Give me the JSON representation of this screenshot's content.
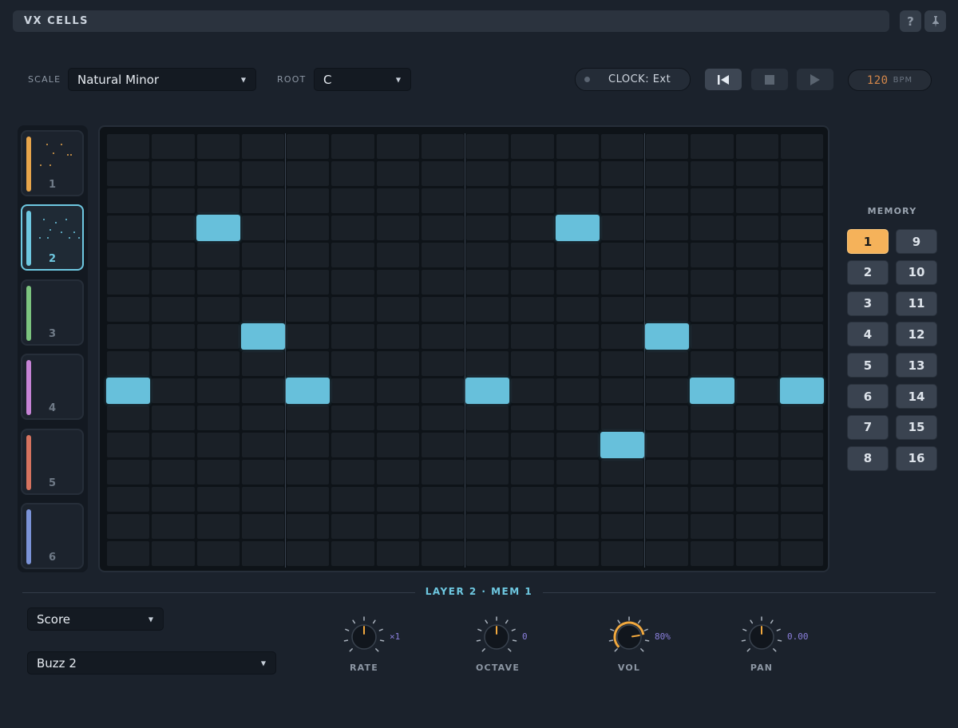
{
  "app": {
    "title": "VX CELLS",
    "help_label": "?",
    "pin_icon": "pin-icon"
  },
  "controls": {
    "scale_label": "SCALE",
    "scale_value": "Natural Minor",
    "root_label": "ROOT",
    "root_value": "C",
    "clock_label": "CLOCK: Ext",
    "bpm_value": "120",
    "bpm_unit": "BPM"
  },
  "layers": [
    {
      "label": "1",
      "color": "#e7a54b"
    },
    {
      "label": "2",
      "color": "#6ec8e1",
      "selected": true
    },
    {
      "label": "3",
      "color": "#7cc47f"
    },
    {
      "label": "4",
      "color": "#c683d6"
    },
    {
      "label": "5",
      "color": "#d6735f"
    },
    {
      "label": "6",
      "color": "#7b93d8"
    }
  ],
  "grid": {
    "columns": 16,
    "rows": 16,
    "notes": [
      {
        "step": 1,
        "row": 10
      },
      {
        "step": 3,
        "row": 4
      },
      {
        "step": 4,
        "row": 8
      },
      {
        "step": 5,
        "row": 10
      },
      {
        "step": 9,
        "row": 10
      },
      {
        "step": 11,
        "row": 4
      },
      {
        "step": 12,
        "row": 12
      },
      {
        "step": 13,
        "row": 8
      },
      {
        "step": 14,
        "row": 10
      },
      {
        "step": 16,
        "row": 10
      }
    ]
  },
  "memory": {
    "title": "MEMORY",
    "slots": [
      "1",
      "9",
      "2",
      "10",
      "3",
      "11",
      "4",
      "12",
      "5",
      "13",
      "6",
      "14",
      "7",
      "15",
      "8",
      "16"
    ],
    "active": "1"
  },
  "bottom": {
    "section_title": "LAYER 2 · MEM 1",
    "mode_value": "Score",
    "sound_value": "Buzz 2",
    "knobs": [
      {
        "label": "RATE",
        "value_text": "×1",
        "level": 0.5
      },
      {
        "label": "OCTAVE",
        "value_text": "0",
        "level": 0.5
      },
      {
        "label": "VOL",
        "value_text": "80%",
        "level": 0.8
      },
      {
        "label": "PAN",
        "value_text": "0.00",
        "level": 0.5
      }
    ]
  }
}
